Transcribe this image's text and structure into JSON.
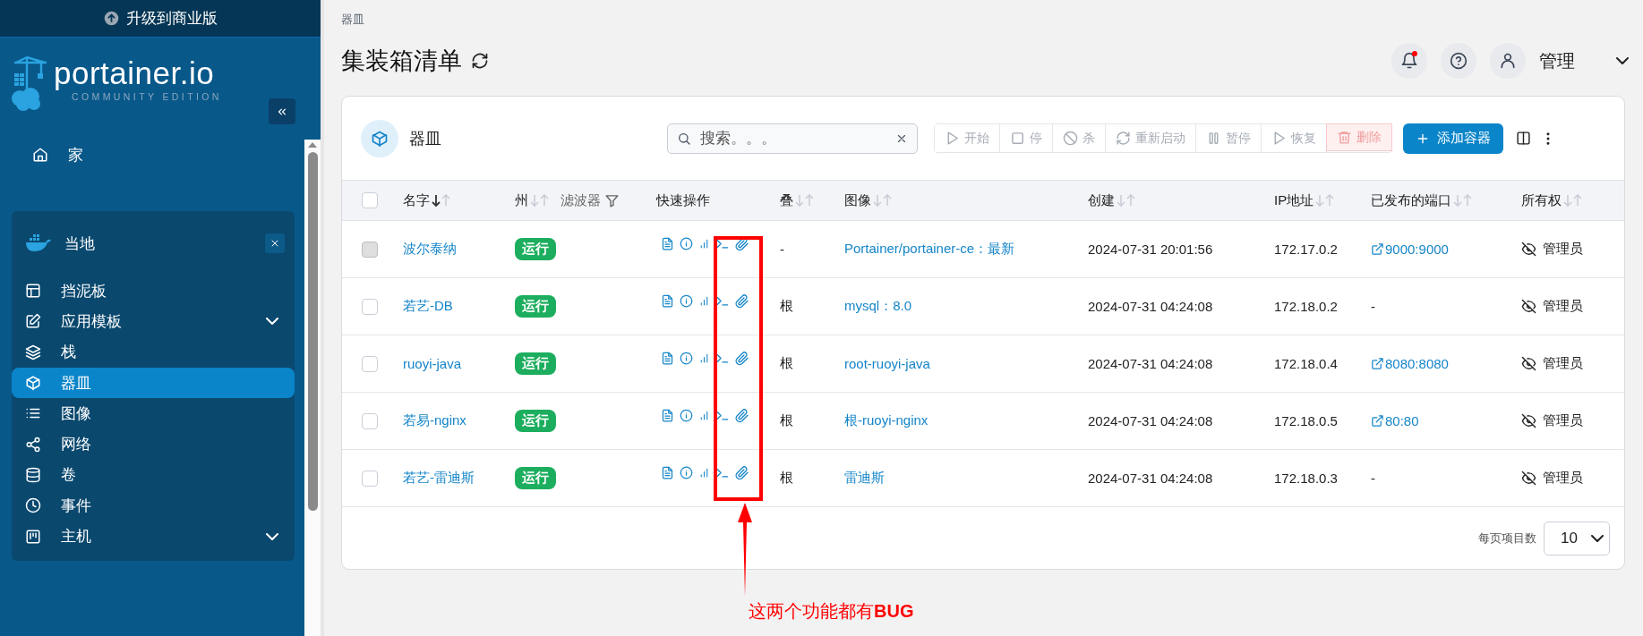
{
  "upgrade_banner": {
    "label": "升级到商业版"
  },
  "logo": {
    "name": "portainer.io",
    "edition": "COMMUNITY EDITION"
  },
  "sidebar": {
    "home": {
      "label": "家",
      "selected": false
    },
    "environment": {
      "name": "当地",
      "items": [
        {
          "label": "挡泥板",
          "selected": false,
          "expandable": false
        },
        {
          "label": "应用模板",
          "selected": false,
          "expandable": true
        },
        {
          "label": "栈",
          "selected": false,
          "expandable": false
        },
        {
          "label": "器皿",
          "selected": true,
          "expandable": false
        },
        {
          "label": "图像",
          "selected": false,
          "expandable": false
        },
        {
          "label": "网络",
          "selected": false,
          "expandable": false
        },
        {
          "label": "卷",
          "selected": false,
          "expandable": false
        },
        {
          "label": "事件",
          "selected": false,
          "expandable": false
        },
        {
          "label": "主机",
          "selected": false,
          "expandable": true
        }
      ]
    }
  },
  "header": {
    "breadcrumb": "器皿",
    "title": "集装箱清单",
    "notifications_unread": true,
    "user": "管理"
  },
  "card": {
    "title": "器皿",
    "search": {
      "placeholder": "搜索。。。"
    },
    "actions": [
      {
        "label": "开始",
        "kind": "normal",
        "disabled": true
      },
      {
        "label": "停",
        "kind": "normal",
        "disabled": true
      },
      {
        "label": "杀",
        "kind": "normal",
        "disabled": true
      },
      {
        "label": "重新启动",
        "kind": "normal",
        "disabled": true
      },
      {
        "label": "暂停",
        "kind": "normal",
        "disabled": true
      },
      {
        "label": "恢复",
        "kind": "normal",
        "disabled": true
      },
      {
        "label": "删除",
        "kind": "danger",
        "disabled": true
      }
    ],
    "add_button": "添加容器"
  },
  "table": {
    "select_all": {
      "checked": false
    },
    "columns": [
      {
        "label": "名字",
        "sorted": true
      },
      {
        "label": "州",
        "sorted": false,
        "filter": "滤波器"
      },
      {
        "label": "快速操作"
      },
      {
        "label": "叠",
        "sorted": false
      },
      {
        "label": "图像",
        "sorted": false
      },
      {
        "label": "创建",
        "sorted": false
      },
      {
        "label": "IP地址",
        "sorted": false
      },
      {
        "label": "已发布的端口",
        "sorted": false
      },
      {
        "label": "所有权",
        "sorted": false
      }
    ],
    "rows": [
      {
        "checked": false,
        "disabled": true,
        "name": "波尔泰纳",
        "status": "运行",
        "stack": "-",
        "image": "Portainer/portainer-ce：最新",
        "created": "2024-07-31 20:01:56",
        "ip": "172.17.0.2",
        "ports": {
          "text": "9000:9000",
          "link": true
        },
        "ownership": "管理员"
      },
      {
        "checked": false,
        "disabled": false,
        "name": "若艺-DB",
        "status": "运行",
        "stack": "根",
        "image": "mysql：8.0",
        "created": "2024-07-31 04:24:08",
        "ip": "172.18.0.2",
        "ports": {
          "text": "-",
          "link": false
        },
        "ownership": "管理员"
      },
      {
        "checked": false,
        "disabled": false,
        "name": "ruoyi-java",
        "status": "运行",
        "stack": "根",
        "image": "root-ruoyi-java",
        "created": "2024-07-31 04:24:08",
        "ip": "172.18.0.4",
        "ports": {
          "text": "8080:8080",
          "link": true
        },
        "ownership": "管理员"
      },
      {
        "checked": false,
        "disabled": false,
        "name": "若易-nginx",
        "status": "运行",
        "stack": "根",
        "image": "根-ruoyi-nginx",
        "created": "2024-07-31 04:24:08",
        "ip": "172.18.0.5",
        "ports": {
          "text": "80:80",
          "link": true
        },
        "ownership": "管理员"
      },
      {
        "checked": false,
        "disabled": false,
        "name": "若艺-雷迪斯",
        "status": "运行",
        "stack": "根",
        "image": "雷迪斯",
        "created": "2024-07-31 04:24:08",
        "ip": "172.18.0.3",
        "ports": {
          "text": "-",
          "link": false
        },
        "ownership": "管理员"
      }
    ],
    "page_size_label": "每页项目数",
    "page_size": "10"
  },
  "annotation": {
    "text": "这两个功能都有**BUG**"
  }
}
